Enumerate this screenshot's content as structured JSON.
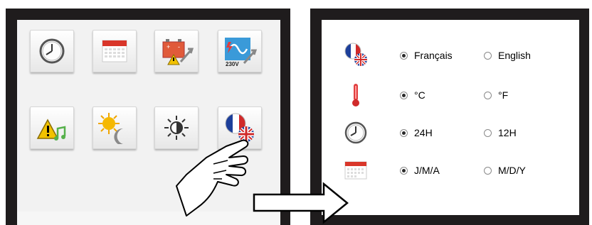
{
  "left_panel": {
    "tiles": [
      {
        "name": "clock-icon"
      },
      {
        "name": "calendar-icon"
      },
      {
        "name": "battery-warning-tools-icon"
      },
      {
        "name": "power-230v-tools-icon"
      },
      {
        "name": "alert-music-icon"
      },
      {
        "name": "sun-moon-icon"
      },
      {
        "name": "brightness-icon"
      },
      {
        "name": "language-flags-icon"
      }
    ],
    "voltage_label": "230V"
  },
  "right_panel": {
    "rows": [
      {
        "icon": "language-flags-icon",
        "option_a": "Français",
        "option_b": "English",
        "selected": "a"
      },
      {
        "icon": "thermometer-icon",
        "option_a": "°C",
        "option_b": "°F",
        "selected": "a"
      },
      {
        "icon": "clock-icon",
        "option_a": "24H",
        "option_b": "12H",
        "selected": "a"
      },
      {
        "icon": "calendar-icon",
        "option_a": "J/M/A",
        "option_b": "M/D/Y",
        "selected": "a"
      }
    ]
  },
  "colors": {
    "frame": "#1f1c1d",
    "calendar_red": "#d9362a",
    "warning_yellow": "#f2c200",
    "music_green": "#55b04a",
    "flag_blue": "#1d3f9a",
    "flag_red": "#d02a2a"
  }
}
